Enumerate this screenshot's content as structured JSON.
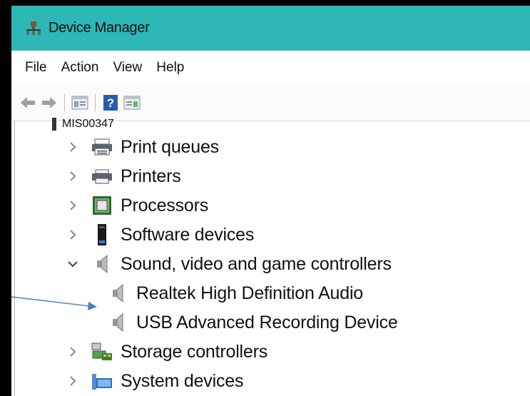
{
  "window": {
    "title": "Device Manager"
  },
  "menu": [
    "File",
    "Action",
    "View",
    "Help"
  ],
  "toolbar": {
    "buttons": [
      "back-arrow-icon",
      "forward-arrow-icon",
      "properties-pane-icon",
      "help-icon",
      "action-pane-icon"
    ]
  },
  "tree": {
    "computer": "MIS00347",
    "items": [
      {
        "label": "Print queues",
        "expanded": false,
        "icon": "print-queue-icon"
      },
      {
        "label": "Printers",
        "expanded": false,
        "icon": "printer-icon"
      },
      {
        "label": "Processors",
        "expanded": false,
        "icon": "processor-icon"
      },
      {
        "label": "Software devices",
        "expanded": false,
        "icon": "software-device-icon"
      },
      {
        "label": "Sound, video and game controllers",
        "expanded": true,
        "icon": "speaker-icon",
        "children": [
          {
            "label": "Realtek High Definition Audio",
            "icon": "speaker-icon"
          },
          {
            "label": "USB Advanced Recording Device",
            "icon": "speaker-icon"
          }
        ]
      },
      {
        "label": "Storage controllers",
        "expanded": false,
        "icon": "storage-controller-icon"
      },
      {
        "label": "System devices",
        "expanded": false,
        "icon": "system-device-icon"
      }
    ]
  },
  "colors": {
    "titlebar": "#2db7b7",
    "arrow": "#4a7fc1"
  }
}
